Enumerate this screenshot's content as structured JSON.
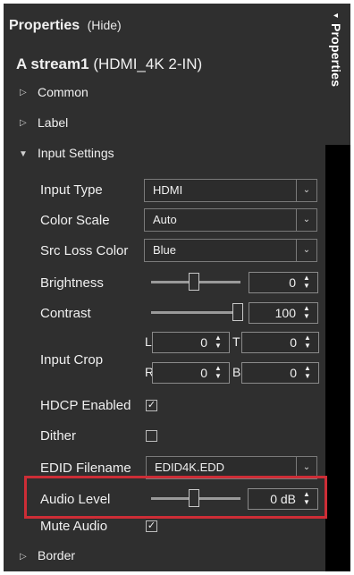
{
  "panel": {
    "title": "Properties",
    "hide_label": "(Hide)",
    "side_tab_label": "Properties",
    "side_tab_arrow": "◂"
  },
  "object": {
    "name": "A stream1",
    "type": "(HDMI_4K 2-IN)"
  },
  "sections": {
    "common": "Common",
    "label": "Label",
    "input_settings": "Input Settings",
    "border": "Border"
  },
  "input": {
    "input_type_label": "Input Type",
    "input_type_value": "HDMI",
    "color_scale_label": "Color Scale",
    "color_scale_value": "Auto",
    "src_loss_label": "Src Loss Color",
    "src_loss_value": "Blue",
    "brightness_label": "Brightness",
    "brightness_value": "0",
    "brightness_level": 0.5,
    "contrast_label": "Contrast",
    "contrast_value": "100",
    "contrast_level": 1.0,
    "crop_label": "Input Crop",
    "crop_L_label": "L",
    "crop_L": "0",
    "crop_T_label": "T",
    "crop_T": "0",
    "crop_R_label": "R",
    "crop_R": "0",
    "crop_B_label": "B",
    "crop_B": "0",
    "hdcp_label": "HDCP Enabled",
    "hdcp_checked": true,
    "dither_label": "Dither",
    "dither_checked": false,
    "edid_label": "EDID Filename",
    "edid_value": "EDID4K.EDD",
    "audio_label": "Audio Level",
    "audio_value": "0 dB",
    "audio_level": 0.5,
    "mute_label": "Mute Audio",
    "mute_checked": true
  },
  "colors": {
    "panel_bg": "#2f2f2f",
    "highlight": "#cd2d36"
  }
}
